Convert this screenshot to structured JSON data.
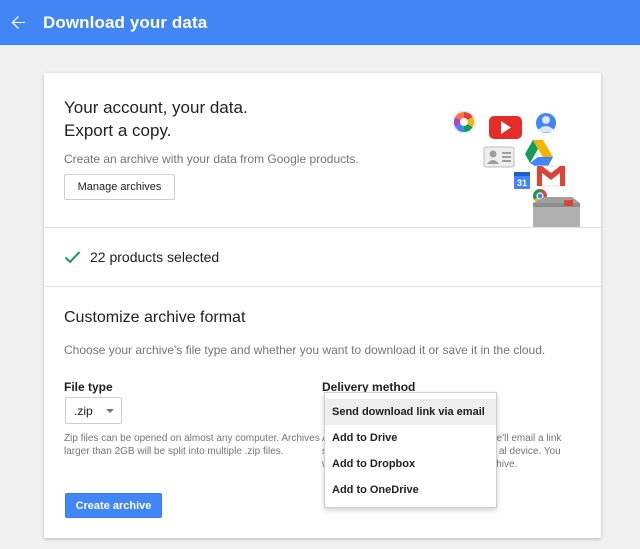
{
  "appbar": {
    "title": "Download your data",
    "back_icon": "arrow-left-icon",
    "color": "#4285f4"
  },
  "hero": {
    "heading_line1": "Your account, your data.",
    "heading_line2": "Export a copy.",
    "description": "Create an archive with your data from Google products.",
    "manage_label": "Manage archives",
    "product_icons": [
      "picasa-icon",
      "youtube-icon",
      "profile-icon",
      "contacts-icon",
      "drive-icon",
      "calendar-icon",
      "gmail-icon",
      "chrome-icon",
      "archive-box-icon"
    ]
  },
  "products": {
    "check_icon": "check-icon",
    "selected_text": "22 products selected",
    "check_color": "#0f9d58"
  },
  "customize": {
    "title": "Customize archive format",
    "description": "Choose your archive's file type and whether you want to download it or save it in the cloud.",
    "file_type_label": "File type",
    "file_type_value": ".zip",
    "file_type_help": "Zip files can be opened on almost any computer. Archives larger than 2GB will be split into multiple .zip files.",
    "delivery_label": "Delivery method",
    "delivery_help_fragments": [
      "A",
      "s",
      "w"
    ],
    "delivery_help_visible": [
      "e'll email a link",
      "al device. You",
      "hive."
    ],
    "delivery_options": [
      "Send download link via email",
      "Add to Drive",
      "Add to Dropbox",
      "Add to OneDrive"
    ],
    "create_label": "Create archive"
  }
}
